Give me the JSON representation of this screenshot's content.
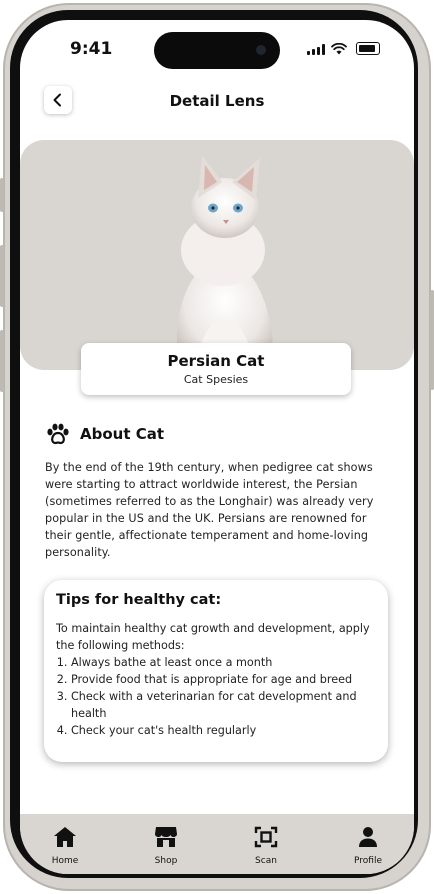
{
  "status_bar": {
    "time": "9:41"
  },
  "header": {
    "title": "Detail Lens",
    "back_icon": "chevron-left-icon"
  },
  "pet": {
    "name": "Persian Cat",
    "category": "Cat Spesies"
  },
  "about": {
    "icon": "paw-icon",
    "heading": "About Cat",
    "body": "By the end of the 19th century, when pedigree cat shows were starting to attract worldwide interest, the Persian (sometimes referred to as the Longhair) was already very popular in the US and the UK. Persians are renowned for their gentle, affectionate temperament and home-loving personality."
  },
  "tips": {
    "heading": "Tips for healthy cat:",
    "intro": "To maintain healthy cat growth and development, apply the following methods:",
    "items": [
      "Always bathe at least once a month",
      "Provide food that is appropriate for age and breed",
      "Check with a veterinarian for cat development and health",
      "Check your cat's health regularly"
    ]
  },
  "bottom_nav": [
    {
      "label": "Home",
      "icon": "home-icon"
    },
    {
      "label": "Shop",
      "icon": "shop-icon"
    },
    {
      "label": "Scan",
      "icon": "scan-icon"
    },
    {
      "label": "Profile",
      "icon": "profile-icon"
    }
  ],
  "colors": {
    "hero_background": "#d9d6d1",
    "nav_background": "#d9d6d1",
    "text": "#111111"
  }
}
